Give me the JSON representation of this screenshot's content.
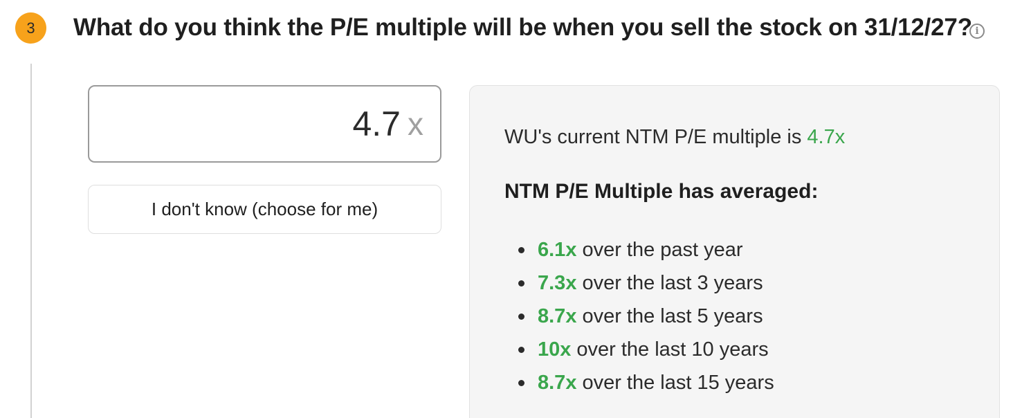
{
  "step": {
    "number": "3"
  },
  "question": {
    "text": "What do you think the P/E multiple will be when you sell the stock on 31/12/27?"
  },
  "info_icon": {
    "glyph": "i",
    "name": "info-icon"
  },
  "input": {
    "value": "4.7",
    "suffix": "x"
  },
  "dont_know_button": {
    "label": "I don't know (choose for me)"
  },
  "panel": {
    "current_prefix": "WU's current NTM P/E multiple is ",
    "current_value": "4.7x",
    "averaged_title": "NTM P/E Multiple has averaged:",
    "averages": [
      {
        "value": "6.1x",
        "text": "over the past year"
      },
      {
        "value": "7.3x",
        "text": "over the last 3 years"
      },
      {
        "value": "8.7x",
        "text": "over the last 5 years"
      },
      {
        "value": "10x",
        "text": "over the last 10 years"
      },
      {
        "value": "8.7x",
        "text": "over the last 15 years"
      }
    ]
  },
  "colors": {
    "badge": "#f7a21b",
    "highlight_green": "#3aa64c",
    "panel_bg": "#f5f5f5"
  }
}
